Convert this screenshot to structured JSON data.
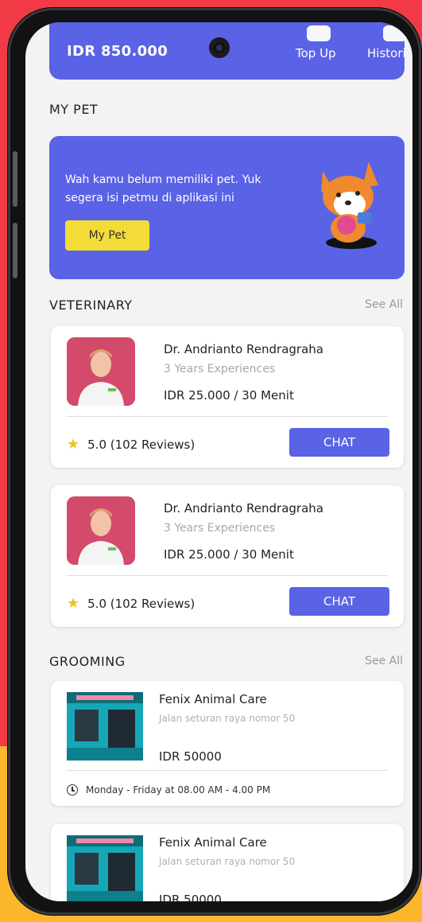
{
  "wallet": {
    "amount": "IDR 850.000",
    "actions": [
      {
        "label": "Top Up",
        "icon": "wallet-icon"
      },
      {
        "label": "Histori",
        "icon": "history-icon"
      }
    ]
  },
  "my_pet": {
    "title": "MY PET",
    "message": "Wah kamu belum memiliki pet. Yuk segera isi petmu di aplikasi ini",
    "button_label": "My Pet"
  },
  "veterinary": {
    "title": "VETERINARY",
    "see_all": "See All",
    "items": [
      {
        "name": "Dr. Andrianto Rendragraha",
        "experience": "3 Years Experiences",
        "price": "IDR 25.000 / 30 Menit",
        "rating": "5.0 (102 Reviews)",
        "chat_label": "CHAT"
      },
      {
        "name": "Dr. Andrianto Rendragraha",
        "experience": "3 Years Experiences",
        "price": "IDR 25.000 / 30 Menit",
        "rating": "5.0 (102 Reviews)",
        "chat_label": "CHAT"
      }
    ]
  },
  "grooming": {
    "title": "GROOMING",
    "see_all": "See All",
    "items": [
      {
        "name": "Fenix Animal Care",
        "address": "Jalan seturan raya nomor 50",
        "price": "IDR 50000",
        "hours": "Monday - Friday at 08.00 AM - 4.00 PM"
      },
      {
        "name": "Fenix Animal Care",
        "address": "Jalan seturan raya nomor 50",
        "price": "IDR 50000"
      }
    ]
  },
  "colors": {
    "primary": "#5a62e6",
    "accent_yellow": "#f3dc37",
    "background_red": "#f13a45",
    "background_yellow": "#fbb62e"
  }
}
